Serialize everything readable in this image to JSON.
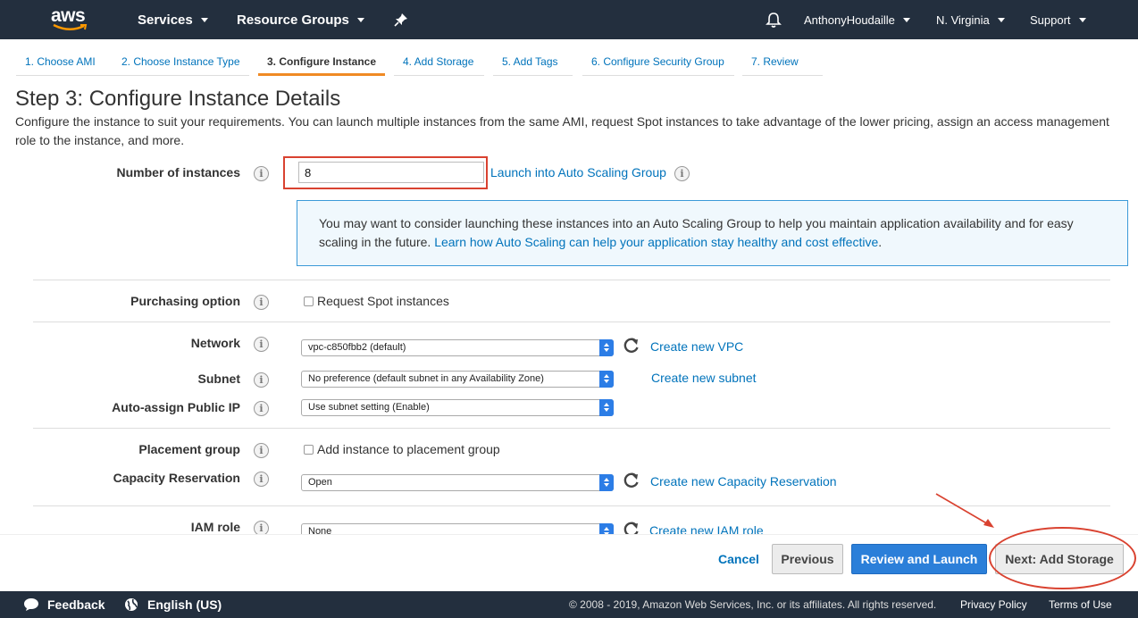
{
  "topnav": {
    "logo": "aws",
    "services": "Services",
    "resource_groups": "Resource Groups",
    "user": "AnthonyHoudaille",
    "region": "N. Virginia",
    "support": "Support"
  },
  "wizard": {
    "tabs": [
      {
        "label": "1. Choose AMI"
      },
      {
        "label": "2. Choose Instance Type"
      },
      {
        "label": "3. Configure Instance"
      },
      {
        "label": "4. Add Storage"
      },
      {
        "label": "5. Add Tags"
      },
      {
        "label": "6. Configure Security Group"
      },
      {
        "label": "7. Review"
      }
    ]
  },
  "page": {
    "title": "Step 3: Configure Instance Details",
    "description": "Configure the instance to suit your requirements. You can launch multiple instances from the same AMI, request Spot instances to take advantage of the lower pricing, assign an access management role to the instance, and more."
  },
  "form": {
    "number_of_instances": {
      "label": "Number of instances",
      "value": "8",
      "link": "Launch into Auto Scaling Group"
    },
    "notice": {
      "text": "You may want to consider launching these instances into an Auto Scaling Group to help you maintain application availability and for easy scaling in the future.",
      "link": "Learn how Auto Scaling can help your application stay healthy and cost effective",
      "end": "."
    },
    "purchasing_option": {
      "label": "Purchasing option",
      "checkbox": "Request Spot instances"
    },
    "network": {
      "label": "Network",
      "value": "vpc-c850fbb2 (default)",
      "link": "Create new VPC"
    },
    "subnet": {
      "label": "Subnet",
      "value": "No preference (default subnet in any Availability Zone)",
      "link": "Create new subnet"
    },
    "public_ip": {
      "label": "Auto-assign Public IP",
      "value": "Use subnet setting (Enable)"
    },
    "placement_group": {
      "label": "Placement group",
      "checkbox": "Add instance to placement group"
    },
    "capacity_reservation": {
      "label": "Capacity Reservation",
      "value": "Open",
      "link": "Create new Capacity Reservation"
    },
    "iam_role": {
      "label": "IAM role",
      "value": "None",
      "link": "Create new IAM role"
    }
  },
  "actions": {
    "cancel": "Cancel",
    "previous": "Previous",
    "review_launch": "Review and Launch",
    "next": "Next: Add Storage"
  },
  "footer": {
    "feedback": "Feedback",
    "language": "English (US)",
    "copyright": "© 2008 - 2019, Amazon Web Services, Inc. or its affiliates. All rights reserved.",
    "privacy": "Privacy Policy",
    "terms": "Terms of Use"
  },
  "colors": {
    "nav_bg": "#232f3e",
    "link": "#0073bb",
    "primary_button": "#2b7fd9",
    "active_tab_underline": "#f08a24",
    "annotation": "#d94230"
  }
}
